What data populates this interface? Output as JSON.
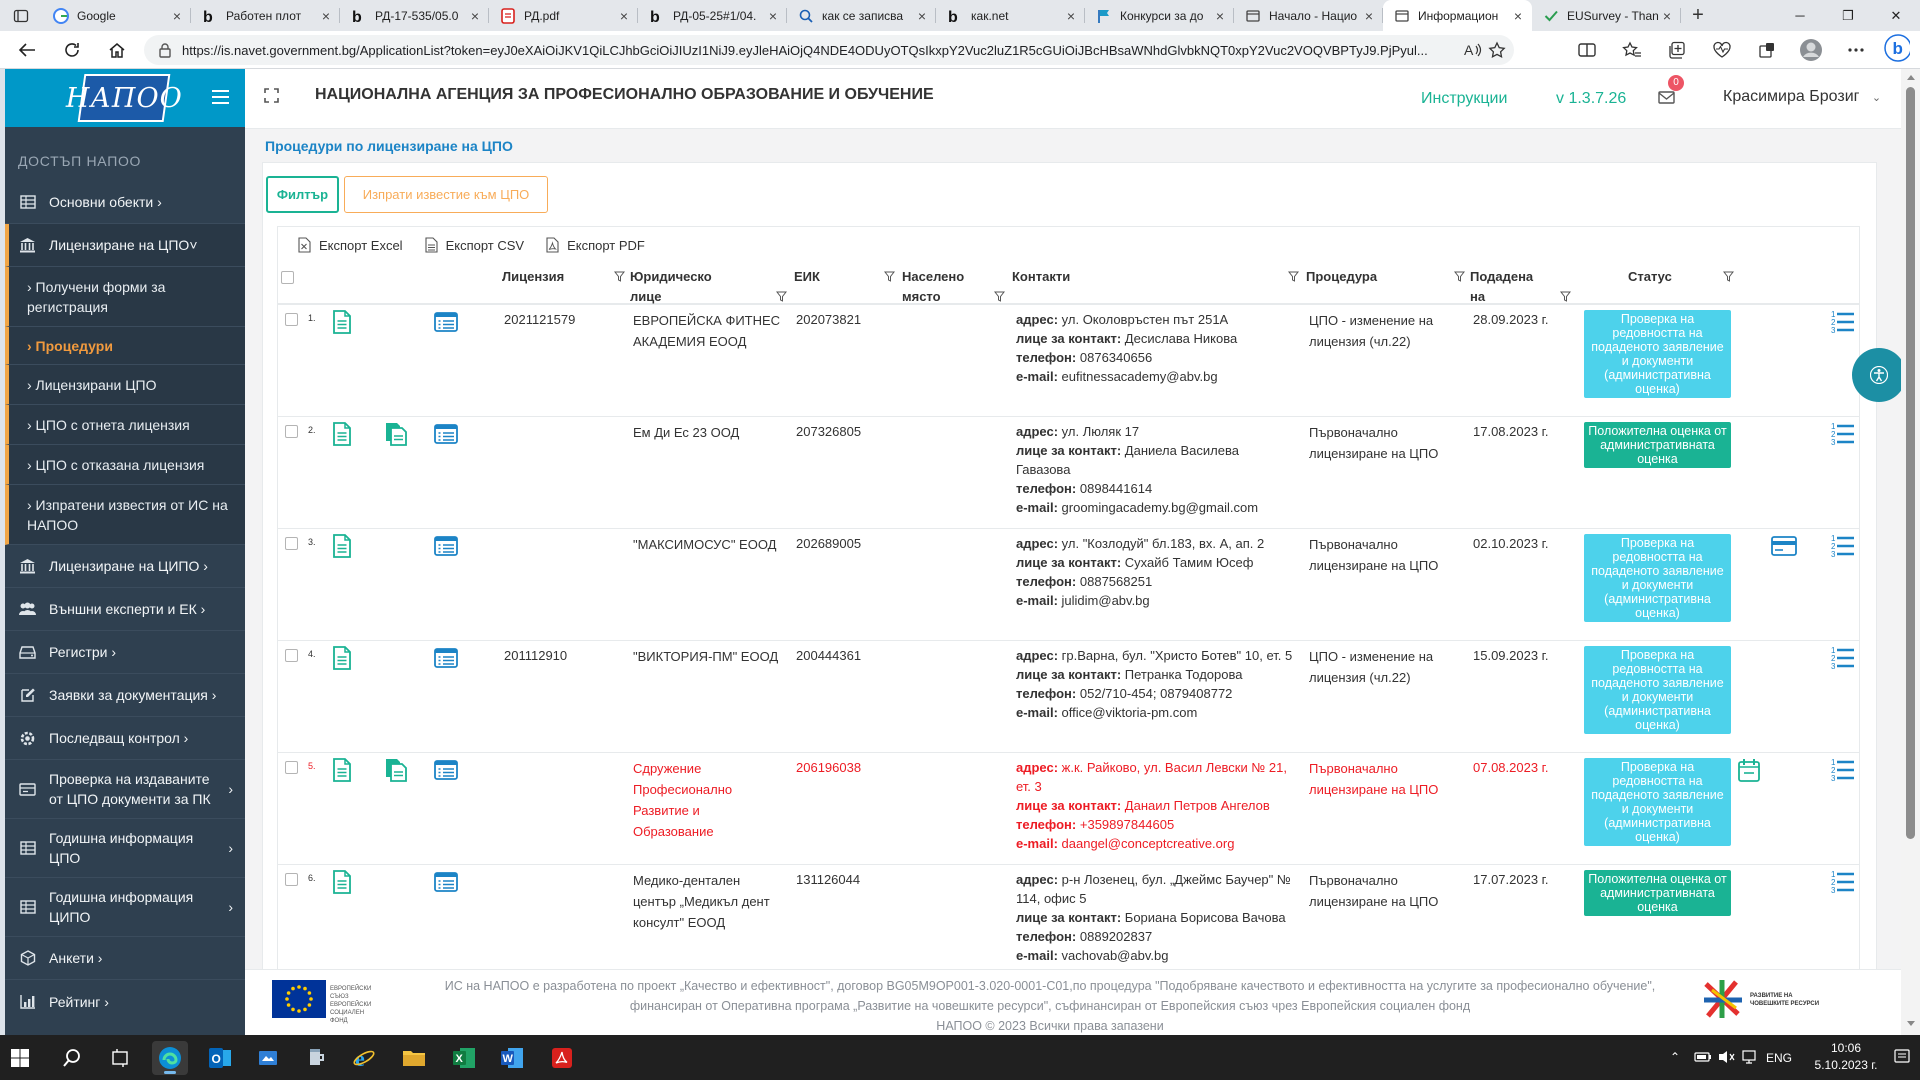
{
  "browser": {
    "tabs": [
      {
        "title": "Google",
        "icon": "google-icon",
        "active": false
      },
      {
        "title": "Работен плот",
        "icon": "bing-b-icon",
        "active": false
      },
      {
        "title": "РД-17-535/05.0",
        "icon": "bing-b-icon",
        "active": false
      },
      {
        "title": "РД.pdf",
        "icon": "pdf-icon",
        "active": false
      },
      {
        "title": "РД-05-25#1/04.",
        "icon": "bing-b-icon",
        "active": false
      },
      {
        "title": "как се записва",
        "icon": "search-icon",
        "active": false
      },
      {
        "title": "как.net",
        "icon": "bing-b-icon",
        "active": false
      },
      {
        "title": "Конкурси за до",
        "icon": "flag-icon",
        "active": false
      },
      {
        "title": "Начало - Нацио",
        "icon": "page-icon",
        "active": false
      },
      {
        "title": "Информацион",
        "icon": "page-icon",
        "active": true
      },
      {
        "title": "EUSurvey - Than",
        "icon": "check-icon",
        "active": false
      }
    ],
    "url": "https://is.navet.government.bg/ApplicationList?token=eyJ0eXAiOiJKV1QiLCJhbGciOiJIUzI1NiJ9.eyJleHAiOjQ4NDE4ODUyOTQsIkxpY2Vuc2luZ1R5cGUiOiJBcHBsaWNhdGlvbkNQT0xpY2Vuc2VOQVBPTyJ9.PjPyul..."
  },
  "app": {
    "logo_text": "НАПОО",
    "sidebar_heading": "ДОСТЪП НАПОО",
    "header_title": "НАЦИОНАЛНА АГЕНЦИЯ ЗА ПРОФЕСИОНАЛНО ОБРАЗОВАНИЕ И ОБУЧЕНИЕ",
    "instructions_link": "Инструкции",
    "version": "v 1.3.7.26",
    "mail_count": "0",
    "user_name": "Красимира Брозиг"
  },
  "sidebar": {
    "items": [
      {
        "label": "Основни обекти ›",
        "icon": "table-icon"
      },
      {
        "label": "Лицензиране на ЦПО˅",
        "icon": "institution-icon"
      },
      {
        "label": "Лицензиране на ЦИПО ›",
        "icon": "institution-icon"
      },
      {
        "label": "Външни експерти и ЕК ›",
        "icon": "users-icon"
      },
      {
        "label": "Регистри ›",
        "icon": "hdd-icon"
      },
      {
        "label": "Заявки за документация ›",
        "icon": "edit-icon"
      },
      {
        "label": "Последващ контрол ›",
        "icon": "settings-icon"
      },
      {
        "label": "Проверка на издаваните от ЦПО документи за ПК",
        "icon": "register-icon"
      },
      {
        "label": "Годишна информация ЦПО",
        "icon": "table-icon"
      },
      {
        "label": "Годишна информация ЦИПО",
        "icon": "table-icon"
      },
      {
        "label": "Анкети ›",
        "icon": "cube-icon"
      },
      {
        "label": "Рейтинг ›",
        "icon": "chart-icon"
      }
    ],
    "sub_items": [
      {
        "label": "› Получени форми за регистрация"
      },
      {
        "label": "› Процедури"
      },
      {
        "label": "› Лицензирани ЦПО"
      },
      {
        "label": "› ЦПО с отнета лицензия"
      },
      {
        "label": "› ЦПО с отказана лицензия"
      },
      {
        "label": "› Изпратени известия от ИС на НАПОО"
      }
    ]
  },
  "page": {
    "breadcrumb": "Процедури по лицензиране на ЦПО",
    "filter_button": "Филтър",
    "notify_button": "Изпрати известие към ЦПО",
    "exports": [
      "Експорт Excel",
      "Експорт CSV",
      "Експорт PDF"
    ],
    "columns": {
      "license": "Лицензия",
      "legal_entity": "Юридическо лице",
      "eik": "ЕИК",
      "settlement": "Населено място",
      "contacts": "Контакти",
      "procedure": "Процедура",
      "submitted": "Подадена на",
      "status": "Статус"
    },
    "labels": {
      "address": "адрес:",
      "contact": "лице за контакт:",
      "phone": "телефон:",
      "email": "e-mail:"
    },
    "rows": [
      {
        "num": "1.",
        "license": "2021121579",
        "entity": "ЕВРОПЕЙСКА ФИТНЕС АКАДЕМИЯ ЕООД",
        "eik": "202073821",
        "settlement": "",
        "address": "ул. Околовръстен път 251А",
        "contact": "Десислава Никова",
        "phone": "0876340656",
        "email": "eufitnessacademy@abv.bg",
        "procedure": "ЦПО - изменение на лицензия (чл.22)",
        "date": "28.09.2023 г.",
        "status": "Проверка на редовността на подаденото заявление и документи (административна оценка)",
        "status_type": "check",
        "has_copy": false,
        "extra_icon": ""
      },
      {
        "num": "2.",
        "license": "",
        "entity": "Ем Ди Ес 23 ООД",
        "eik": "207326805",
        "settlement": "",
        "address": "ул. Люляк 17",
        "contact": "Даниела Василева Гавазова",
        "phone": "0898441614",
        "email": "groomingacademy.bg@gmail.com",
        "procedure": "Първоначално лицензиране на ЦПО",
        "date": "17.08.2023 г.",
        "status": "Положителна оценка от административната оценка",
        "status_type": "ok",
        "has_copy": true,
        "extra_icon": ""
      },
      {
        "num": "3.",
        "license": "",
        "entity": "\"МАКСИМОСУС\" ЕООД",
        "eik": "202689005",
        "settlement": "",
        "address": "ул. \"Козлодуй\" бл.183, вх. А, ап. 2",
        "contact": "Сухайб Тамим Юсеф",
        "phone": "0887568251",
        "email": "julidim@abv.bg",
        "procedure": "Първоначално лицензиране на ЦПО",
        "date": "02.10.2023 г.",
        "status": "Проверка на редовността на подаденото заявление и документи (административна оценка)",
        "status_type": "check",
        "has_copy": false,
        "extra_icon": "card"
      },
      {
        "num": "4.",
        "license": "201112910",
        "entity": "\"ВИКТОРИЯ-ПМ\" ЕООД",
        "eik": "200444361",
        "settlement": "",
        "address": "гр.Варна, бул. \"Христо Ботев\" 10, ет. 5",
        "contact": "Петранка Тодорова",
        "phone": "052/710-454; 0879408772",
        "email": "office@viktoria-pm.com",
        "procedure": "ЦПО - изменение на лицензия (чл.22)",
        "date": "15.09.2023 г.",
        "status": "Проверка на редовността на подаденото заявление и документи (административна оценка)",
        "status_type": "check",
        "has_copy": false,
        "extra_icon": ""
      },
      {
        "num": "5.",
        "license": "",
        "entity": "Сдружение Професионално Развитие и Образование",
        "eik": "206196038",
        "settlement": "",
        "address": "ж.к. Райково, ул. Васил Левски № 21, ет. 3",
        "contact": "Данаил Петров Ангелов",
        "phone": "+359897844605",
        "email": "daangel@conceptcreative.org",
        "procedure": "Първоначално лицензиране на ЦПО",
        "date": "07.08.2023 г.",
        "status": "Проверка на редовността на подаденото заявление и документи (административна оценка)",
        "status_type": "check",
        "has_copy": true,
        "extra_icon": "calendar",
        "red": true
      },
      {
        "num": "6.",
        "license": "",
        "entity": "Медико-дентален център „Медикъл дент консулт\" ЕООД",
        "eik": "131126044",
        "settlement": "",
        "address": "р-н Лозенец, бул. „Джеймс Баучер\" № 114, офис 5",
        "contact": "Бориана Борисова Вачова",
        "phone": "0889202837",
        "email": "vachovab@abv.bg",
        "procedure": "Първоначално лицензиране на ЦПО",
        "date": "17.07.2023 г.",
        "status": "Положителна оценка от административната оценка",
        "status_type": "ok",
        "has_copy": false,
        "extra_icon": ""
      }
    ]
  },
  "footer": {
    "line1": "ИС на НАПОО е разработена по проект „Качество и ефективност\", договор BG05M9OP001-3.020-0001-C01,по процедура \"Подобряване качеството и ефективността на услугите за професионално обучение\", финансиран от Оперативна програма „Развитие на човешките ресурси\", съфинансиран от Европейския съюз чрез Европейския социален фонд",
    "line2": "НАПОО © 2023 Всички права запазени",
    "eu_logo_text": "ЕВРОПЕЙСКИ СЪЮЗ ЕВРОПЕЙСКИ СОЦИАЛЕН ФОНД",
    "esf_logo_text": "РАЗВИТИЕ НА ЧОВЕШКИТЕ РЕСУРСИ"
  },
  "taskbar": {
    "lang": "ENG",
    "time": "10:06",
    "date": "5.10.2023 г."
  },
  "colors": {
    "sidebar": "#2f4050",
    "brand": "#0098c8",
    "link": "#1c84c6",
    "filter": "#1ab394",
    "notify": "#f8ac59",
    "status_check": "#4dd2eb",
    "status_ok": "#1ab394",
    "error": "#ed1c24"
  }
}
